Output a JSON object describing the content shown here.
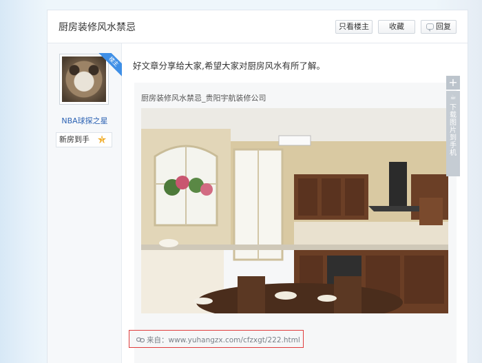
{
  "post": {
    "title": "厨房装修风水禁忌",
    "body_text": "好文章分享给大家,希望大家对厨房风水有所了解。"
  },
  "header_buttons": {
    "only_op": "只看楼主",
    "favorite": "收藏",
    "reply": "回复"
  },
  "author": {
    "name": "NBA球探之星",
    "badge": "楼主",
    "rank": "新房到手",
    "level": "1"
  },
  "quote": {
    "title": "厨房装修风水禁忌_贵阳宇航装修公司",
    "source_label": "来自：www.yuhangzx.com/cfzxgt/222.html"
  },
  "side_tools": {
    "plus": "+",
    "download_label": "下载图片到手机"
  },
  "colors": {
    "accent": "#3f8fe6",
    "link": "#2c62b3",
    "highlight_border": "#e03b3b",
    "star": "#f0a91f"
  }
}
